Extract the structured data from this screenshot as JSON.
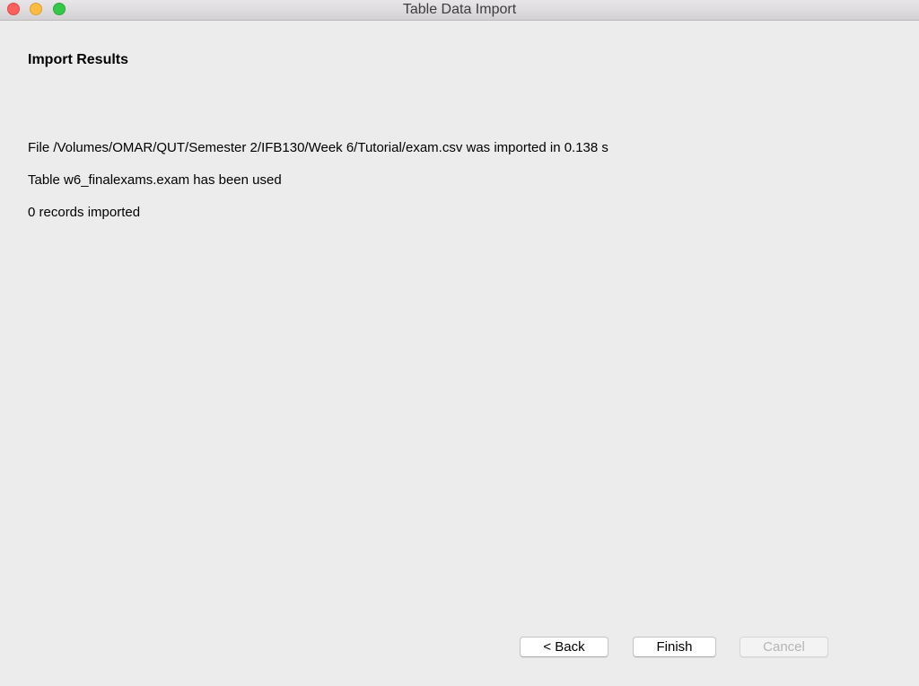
{
  "window": {
    "title": "Table Data Import"
  },
  "page": {
    "heading": "Import Results",
    "messages": [
      "File /Volumes/OMAR/QUT/Semester 2/IFB130/Week 6/Tutorial/exam.csv was imported in 0.138 s",
      "Table w6_finalexams.exam has been used",
      "0 records imported"
    ]
  },
  "buttons": {
    "back": "< Back",
    "finish": "Finish",
    "cancel": "Cancel"
  },
  "colors": {
    "close": "#fc605c",
    "minimize": "#fdbc40",
    "maximize": "#34c84a"
  }
}
